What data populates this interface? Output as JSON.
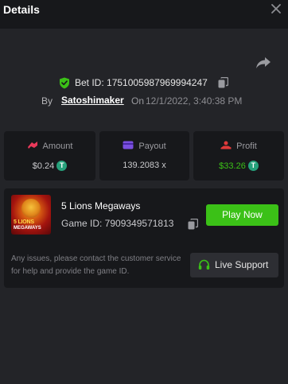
{
  "header": {
    "title": "Details"
  },
  "bet": {
    "id_text": "Bet ID: 1751005987969994247",
    "by_label": "By",
    "user": "Satoshimaker",
    "on_label": "On",
    "date": "12/1/2022, 3:40:38 PM"
  },
  "stats": {
    "amount": {
      "label": "Amount",
      "value": "$0.24"
    },
    "payout": {
      "label": "Payout",
      "value": "139.2083 x"
    },
    "profit": {
      "label": "Profit",
      "value": "$33.26"
    }
  },
  "game": {
    "name": "5 Lions Megaways",
    "id_text": "Game ID: 7909349571813",
    "thumb_line1": "5 LIONS",
    "thumb_line2": "MEGAWAYS",
    "play_label": "Play Now",
    "note": "Any issues, please contact the customer service for help and provide the game ID.",
    "support_label": "Live Support"
  },
  "colors": {
    "accent_green": "#3bc117",
    "profit_green": "#3bc117",
    "amount_icon": "#e8395a",
    "payout_icon": "#7a4fe0",
    "profit_icon": "#e03a3a",
    "coin": "#26a17b"
  },
  "icons": {
    "close": "close-icon",
    "share": "share-icon",
    "verified": "shield-check-icon",
    "copy": "copy-icon",
    "amount": "amount-icon",
    "payout": "wallet-icon",
    "profit": "profit-icon",
    "coin": "tether-coin-icon",
    "support": "headset-icon"
  }
}
